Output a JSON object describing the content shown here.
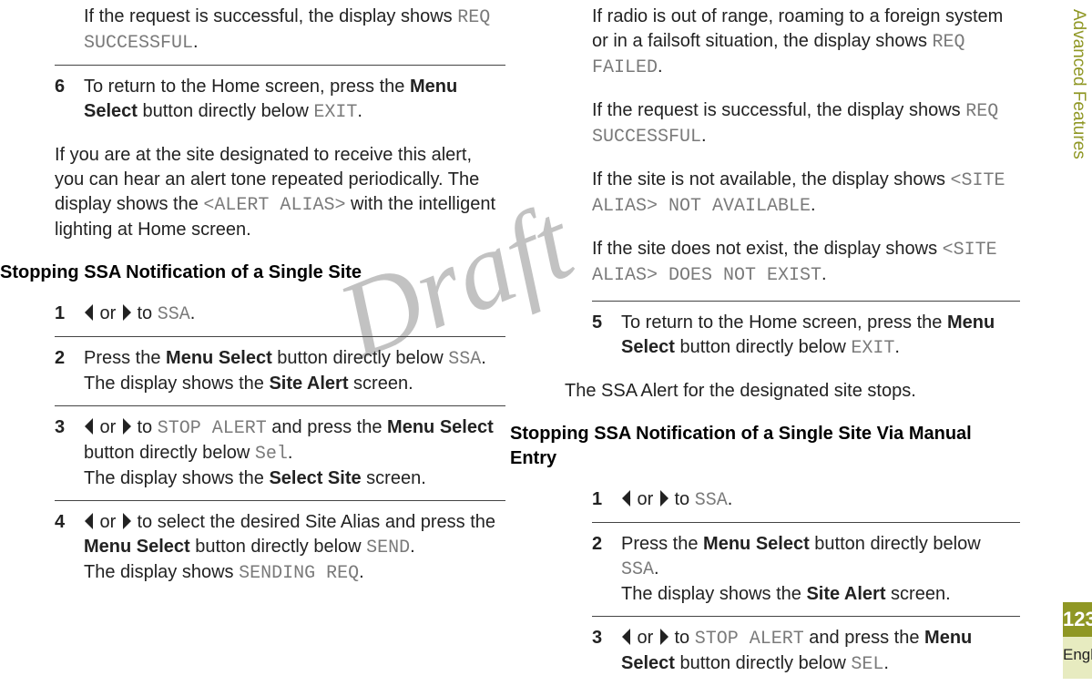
{
  "sidebar": {
    "section": "Advanced Features",
    "page": "123",
    "lang": "English"
  },
  "watermark": "Draft",
  "left": {
    "step_intro": {
      "t1": "If the request is successful, the display shows ",
      "c1": "REQ SUCCESSFUL",
      "t2": "."
    },
    "step6": {
      "num": "6",
      "t1": "To return to the Home screen, press the ",
      "b1": "Menu Select",
      "t2": " button directly below ",
      "c1": "EXIT",
      "t3": "."
    },
    "after6": {
      "t1": "If you are at the site designated to receive this alert, you can hear an alert tone repeated periodically. The display shows the ",
      "c1": "<ALERT ALIAS>",
      "t2": " with the intelligent lighting at Home screen."
    },
    "heading1": "Stopping SSA Notification of a Single Site",
    "s1": {
      "num": "1",
      "t1": " or ",
      "t2": " to ",
      "c1": "SSA",
      "t3": "."
    },
    "s2": {
      "num": "2",
      "t1": "Press the ",
      "b1": "Menu Select",
      "t2": " button directly below ",
      "c1": "SSA",
      "t3": ".",
      "t4": "The display shows the ",
      "b2": "Site Alert",
      "t5": " screen."
    },
    "s3": {
      "num": "3",
      "t1": " or ",
      "t2": " to ",
      "c1": "STOP ALERT",
      "t3": " and press the ",
      "b1": "Menu Select",
      "t4": " button directly below ",
      "c2": "Sel",
      "t5": ".",
      "t6": "The display shows the ",
      "b2": "Select Site",
      "t7": " screen."
    },
    "s4": {
      "num": "4",
      "t1": " or ",
      "t2": " to select the desired Site Alias and press the ",
      "b1": "Menu Select",
      "t3": " button directly below ",
      "c1": "SEND",
      "t4": ".",
      "t5": "The display shows ",
      "c2": "SENDING REQ",
      "t6": "."
    }
  },
  "right": {
    "p1": {
      "t1": "If radio is out of range, roaming to a foreign system or in a failsoft situation, the display shows ",
      "c1": "REQ FAILED",
      "t2": "."
    },
    "p2": {
      "t1": "If the request is successful, the display shows ",
      "c1": "REQ SUCCESSFUL",
      "t2": "."
    },
    "p3": {
      "t1": "If the site is not available, the display shows ",
      "c1": "<SITE ALIAS> NOT AVAILABLE",
      "t2": "."
    },
    "p4": {
      "t1": "If the site does not exist, the display shows ",
      "c1": "<SITE ALIAS> DOES NOT EXIST",
      "t2": "."
    },
    "s5": {
      "num": "5",
      "t1": "To return to the Home screen, press the ",
      "b1": "Menu Select",
      "t2": " button directly below ",
      "c1": "EXIT",
      "t3": "."
    },
    "after5": "The SSA Alert for the designated site stops.",
    "heading2": "Stopping SSA Notification of a Single Site Via Manual Entry",
    "r1": {
      "num": "1",
      "t1": " or ",
      "t2": " to ",
      "c1": "SSA",
      "t3": "."
    },
    "r2": {
      "num": "2",
      "t1": "Press the ",
      "b1": "Menu Select",
      "t2": " button directly below ",
      "c1": "SSA",
      "t3": ".",
      "t4": "The display shows the ",
      "b2": "Site Alert",
      "t5": " screen."
    },
    "r3": {
      "num": "3",
      "t1": " or ",
      "t2": " to ",
      "c1": "STOP ALERT",
      "t3": " and press the ",
      "b1": "Menu Select",
      "t4": " button directly below ",
      "c2": "SEL",
      "t5": "."
    }
  }
}
